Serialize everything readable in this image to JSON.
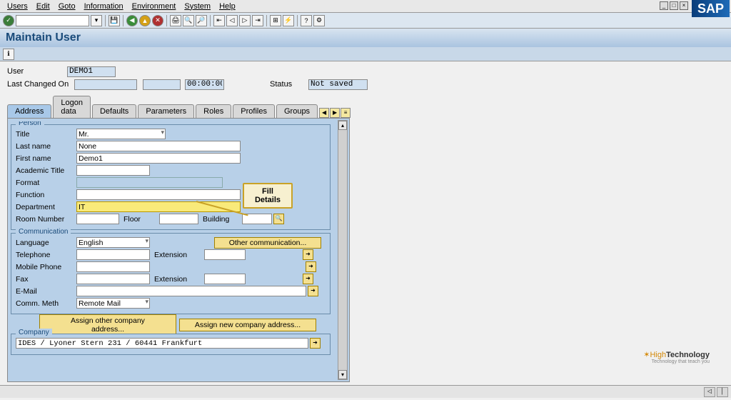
{
  "menubar": {
    "items": [
      "Users",
      "Edit",
      "Goto",
      "Information",
      "Environment",
      "System",
      "Help"
    ]
  },
  "title": "Maintain User",
  "header": {
    "user_label": "User",
    "user_value": "DEMO1",
    "lastchanged_label": "Last Changed On",
    "lastchanged_name": "",
    "lastchanged_date": "",
    "lastchanged_time": "00:00:00",
    "status_label": "Status",
    "status_value": "Not saved"
  },
  "tabs": [
    "Address",
    "Logon data",
    "Defaults",
    "Parameters",
    "Roles",
    "Profiles",
    "Groups"
  ],
  "active_tab": "Address",
  "person": {
    "group_label": "Person",
    "title_label": "Title",
    "title": "Mr.",
    "lastname_label": "Last name",
    "lastname": "None",
    "firstname_label": "First name",
    "firstname": "Demo1",
    "academic_label": "Academic Title",
    "academic": "",
    "format_label": "Format",
    "format": "",
    "function_label": "Function",
    "function": "",
    "department_label": "Department",
    "department": "IT",
    "room_label": "Room Number",
    "room": "",
    "floor_label": "Floor",
    "floor": "",
    "building_label": "Building",
    "building": ""
  },
  "communication": {
    "group_label": "Communication",
    "language_label": "Language",
    "language": "English",
    "other_comm_btn": "Other communication...",
    "telephone_label": "Telephone",
    "telephone": "",
    "extension_label": "Extension",
    "extension1": "",
    "mobile_label": "Mobile Phone",
    "mobile": "",
    "fax_label": "Fax",
    "fax": "",
    "extension2": "",
    "email_label": "E-Mail",
    "email": "",
    "method_label": "Comm. Meth",
    "method": "Remote Mail"
  },
  "company": {
    "assign_other_btn": "Assign other company address...",
    "assign_new_btn": "Assign new company address...",
    "group_label": "Company",
    "company_value": "IDES / Lyoner Stern 231 / 60441 Frankfurt"
  },
  "callout": "Fill Details",
  "watermark": {
    "brand": "High",
    "brand2": "Technology",
    "tag": "Technology that teach you"
  }
}
